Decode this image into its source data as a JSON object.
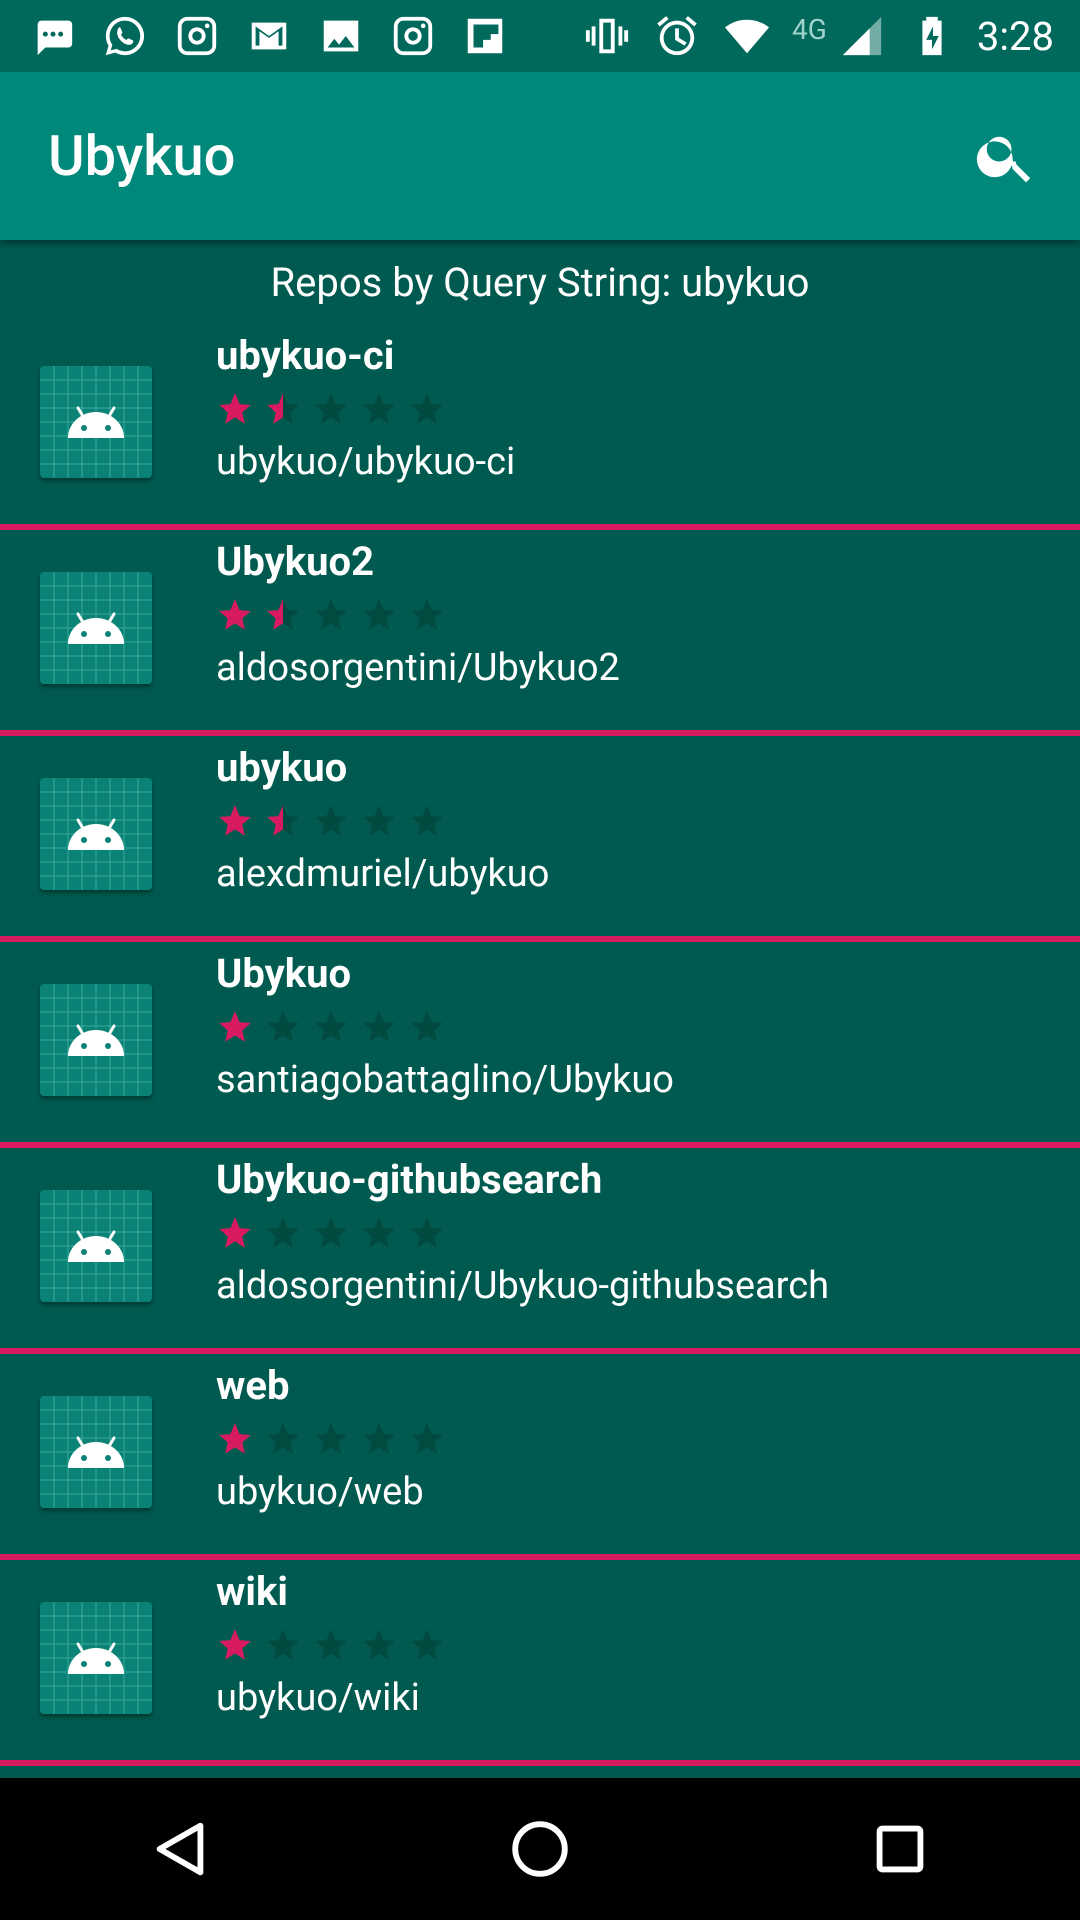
{
  "status_bar": {
    "time": "3:28",
    "network": "4G",
    "left_icons": [
      "message-icon",
      "whatsapp-icon",
      "instagram-icon",
      "gmail-icon",
      "gallery-icon",
      "instagram-icon",
      "flipboard-icon"
    ],
    "right_icons": [
      "vibrate-icon",
      "alarm-icon",
      "wifi-icon",
      "signal-icon",
      "battery-charging-icon"
    ]
  },
  "app_bar": {
    "title": "Ubykuo",
    "search_icon": "search-icon"
  },
  "header": {
    "query_label": "Repos by Query String: ubykuo"
  },
  "colors": {
    "status_bar": "#00695c",
    "app_bar": "#00897b",
    "background": "#005a4f",
    "accent": "#d81b60",
    "star_empty": "#004a40"
  },
  "repos": [
    {
      "name": "ubykuo-ci",
      "path": "ubykuo/ubykuo-ci",
      "rating": 1.5
    },
    {
      "name": "Ubykuo2",
      "path": "aldosorgentini/Ubykuo2",
      "rating": 1.5
    },
    {
      "name": "ubykuo",
      "path": "alexdmuriel/ubykuo",
      "rating": 1.5
    },
    {
      "name": "Ubykuo",
      "path": "santiagobattaglino/Ubykuo",
      "rating": 1
    },
    {
      "name": "Ubykuo-githubsearch",
      "path": "aldosorgentini/Ubykuo-githubsearch",
      "rating": 1
    },
    {
      "name": "web",
      "path": "ubykuo/web",
      "rating": 1
    },
    {
      "name": "wiki",
      "path": "ubykuo/wiki",
      "rating": 1
    }
  ],
  "nav_bar": {
    "back_icon": "back-icon",
    "home_icon": "home-icon",
    "recents_icon": "recents-icon"
  }
}
